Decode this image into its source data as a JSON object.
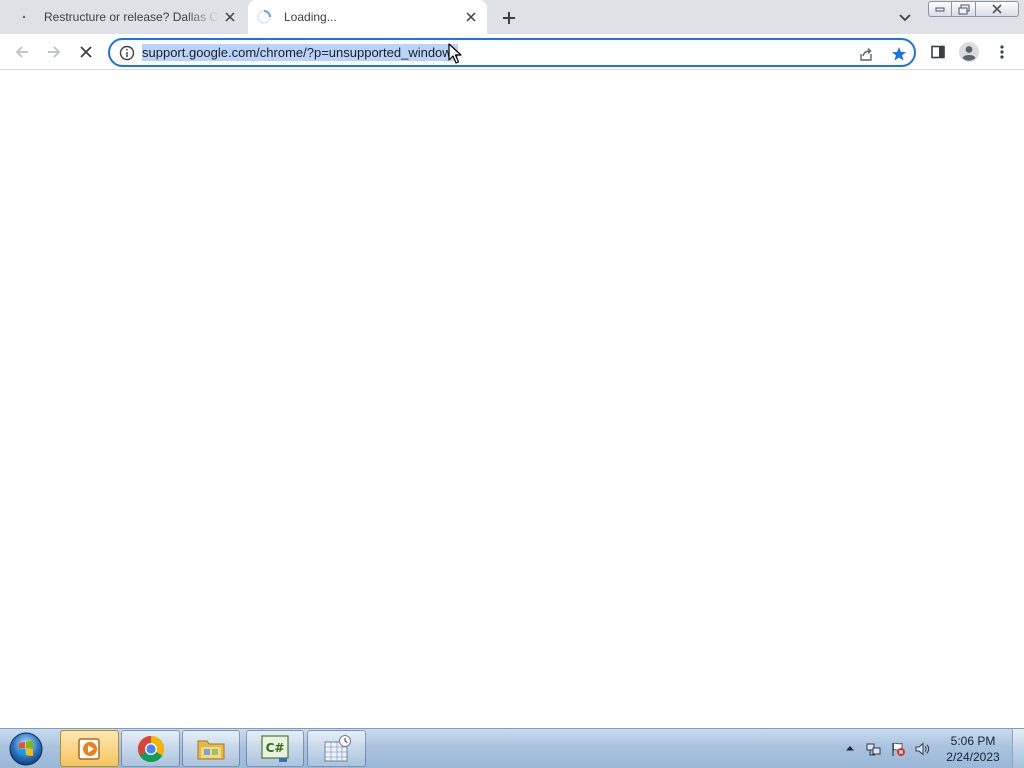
{
  "tabs": [
    {
      "title": "Restructure or release? Dallas Co",
      "state": "loaded",
      "active": false
    },
    {
      "title": "Loading...",
      "state": "loading",
      "active": true
    }
  ],
  "toolbar": {
    "url": "support.google.com/chrome/?p=unsupported_windows",
    "url_selected": true,
    "bookmarked": true,
    "page_loading": true
  },
  "taskbar": {
    "apps": [
      "windows-media-player-icon",
      "chrome-icon",
      "file-explorer-icon",
      "csharp-editor-icon",
      "tool-icon"
    ],
    "clock": {
      "time": "5:06 PM",
      "date": "2/24/2023"
    }
  },
  "colors": {
    "accent": "#1a73e8",
    "selection": "#b9d3fb",
    "tabstrip": "#dee1e6",
    "taskbar": "#a9c3de"
  }
}
